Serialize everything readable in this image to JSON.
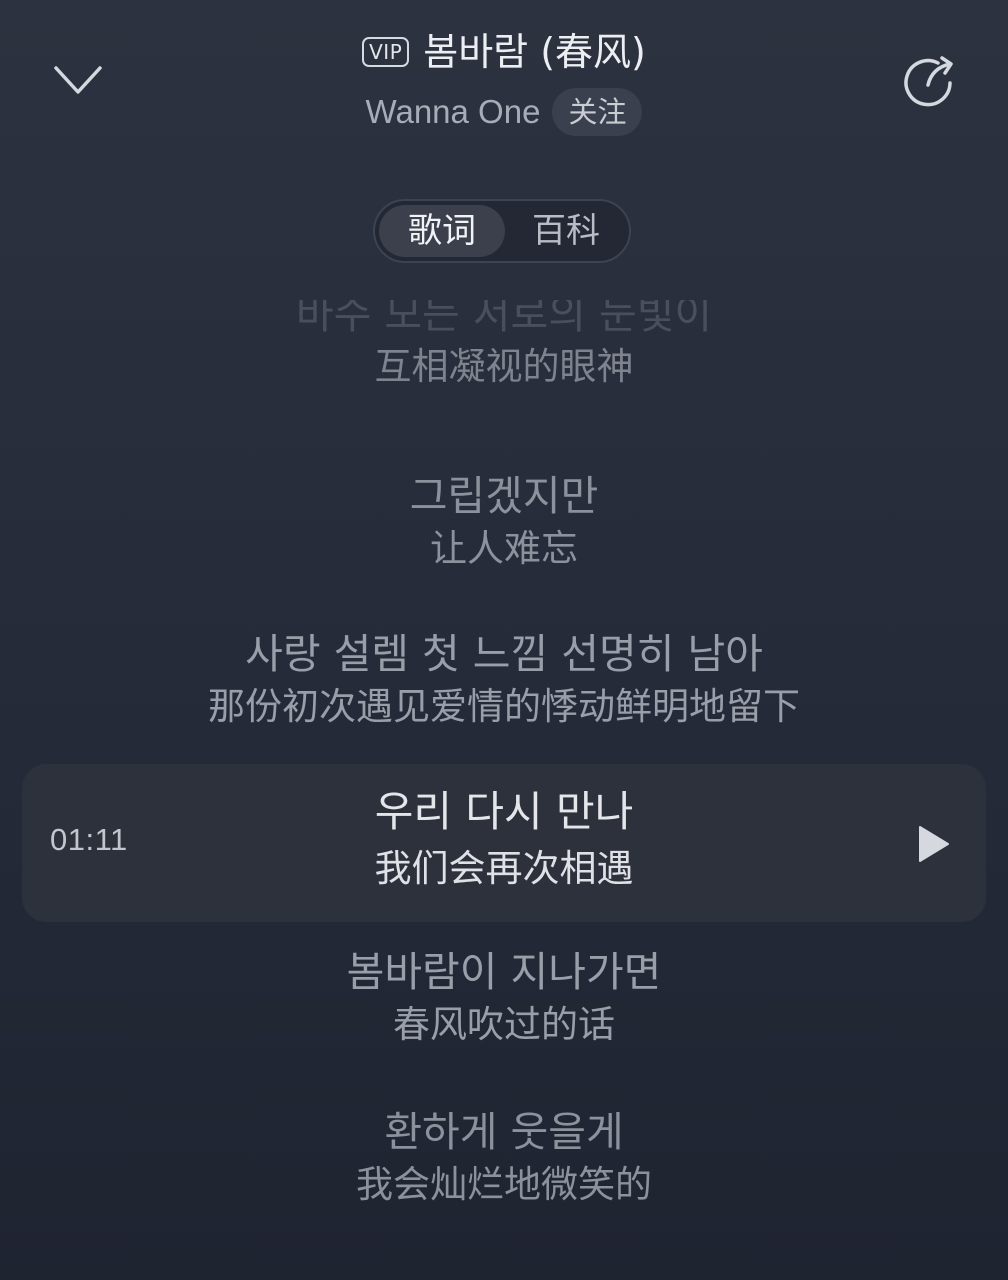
{
  "header": {
    "vip_badge": "VIP",
    "song_title": "봄바람 (春风)",
    "artist": "Wanna One",
    "follow_label": "关注"
  },
  "tabs": [
    {
      "label": "歌词",
      "active": true
    },
    {
      "label": "百科",
      "active": false
    }
  ],
  "lyrics": [
    {
      "ko": "바수 모든 서로의 눈빛이",
      "zh": "互相凝视的眼神"
    },
    {
      "ko": "그립겠지만",
      "zh": "让人难忘"
    },
    {
      "ko": "사랑 설렘 첫 느낌 선명히 남아",
      "zh": "那份初次遇见爱情的悸动鲜明地留下"
    },
    {
      "ko": "우리 다시 만나",
      "zh": "我们会再次相遇"
    },
    {
      "ko": "봄바람이 지나가면",
      "zh": "春风吹过的话"
    },
    {
      "ko": "환하게 웃을게",
      "zh": "我会灿烂地微笑的"
    }
  ],
  "current_line": {
    "time": "01:11"
  },
  "icons": {
    "collapse": "chevron-down-icon",
    "share": "share-icon",
    "play": "play-icon"
  },
  "colors": {
    "background": "#272d3a",
    "highlight_row": "#2c313c"
  }
}
